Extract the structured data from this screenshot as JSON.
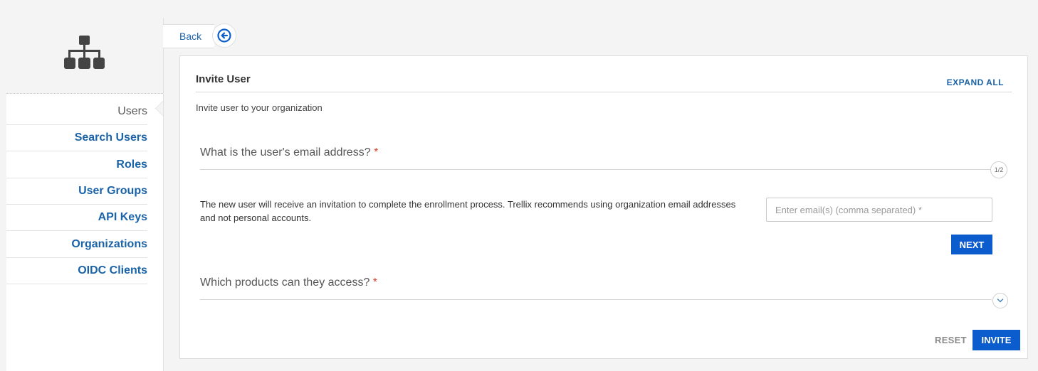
{
  "sidebar": {
    "logo_icon": "org-hierarchy-icon",
    "items": [
      {
        "label": "Users",
        "current": true
      },
      {
        "label": "Search Users"
      },
      {
        "label": "Roles"
      },
      {
        "label": "User Groups"
      },
      {
        "label": "API Keys"
      },
      {
        "label": "Organizations"
      },
      {
        "label": "OIDC Clients"
      }
    ]
  },
  "back": {
    "label": "Back",
    "icon": "arrow-left-circle-icon"
  },
  "card": {
    "title": "Invite User",
    "expand_all": "EXPAND ALL",
    "subtitle": "Invite user to your organization",
    "step1": {
      "question": "What is the user's email address?",
      "required_mark": "*",
      "step_label": "1/2",
      "description": "The new user will receive an invitation to complete the enrollment process. Trellix recommends using organization email addresses and not personal accounts.",
      "email_placeholder": "Enter email(s) (comma separated) *",
      "email_value": "",
      "next_label": "NEXT"
    },
    "step2": {
      "question": "Which products can they access?",
      "required_mark": "*",
      "expand_icon": "chevron-down-icon"
    },
    "reset_label": "RESET",
    "invite_label": "INVITE"
  },
  "colors": {
    "accent": "#0b5ccd",
    "link": "#1a63a8",
    "required": "#d9442f"
  }
}
